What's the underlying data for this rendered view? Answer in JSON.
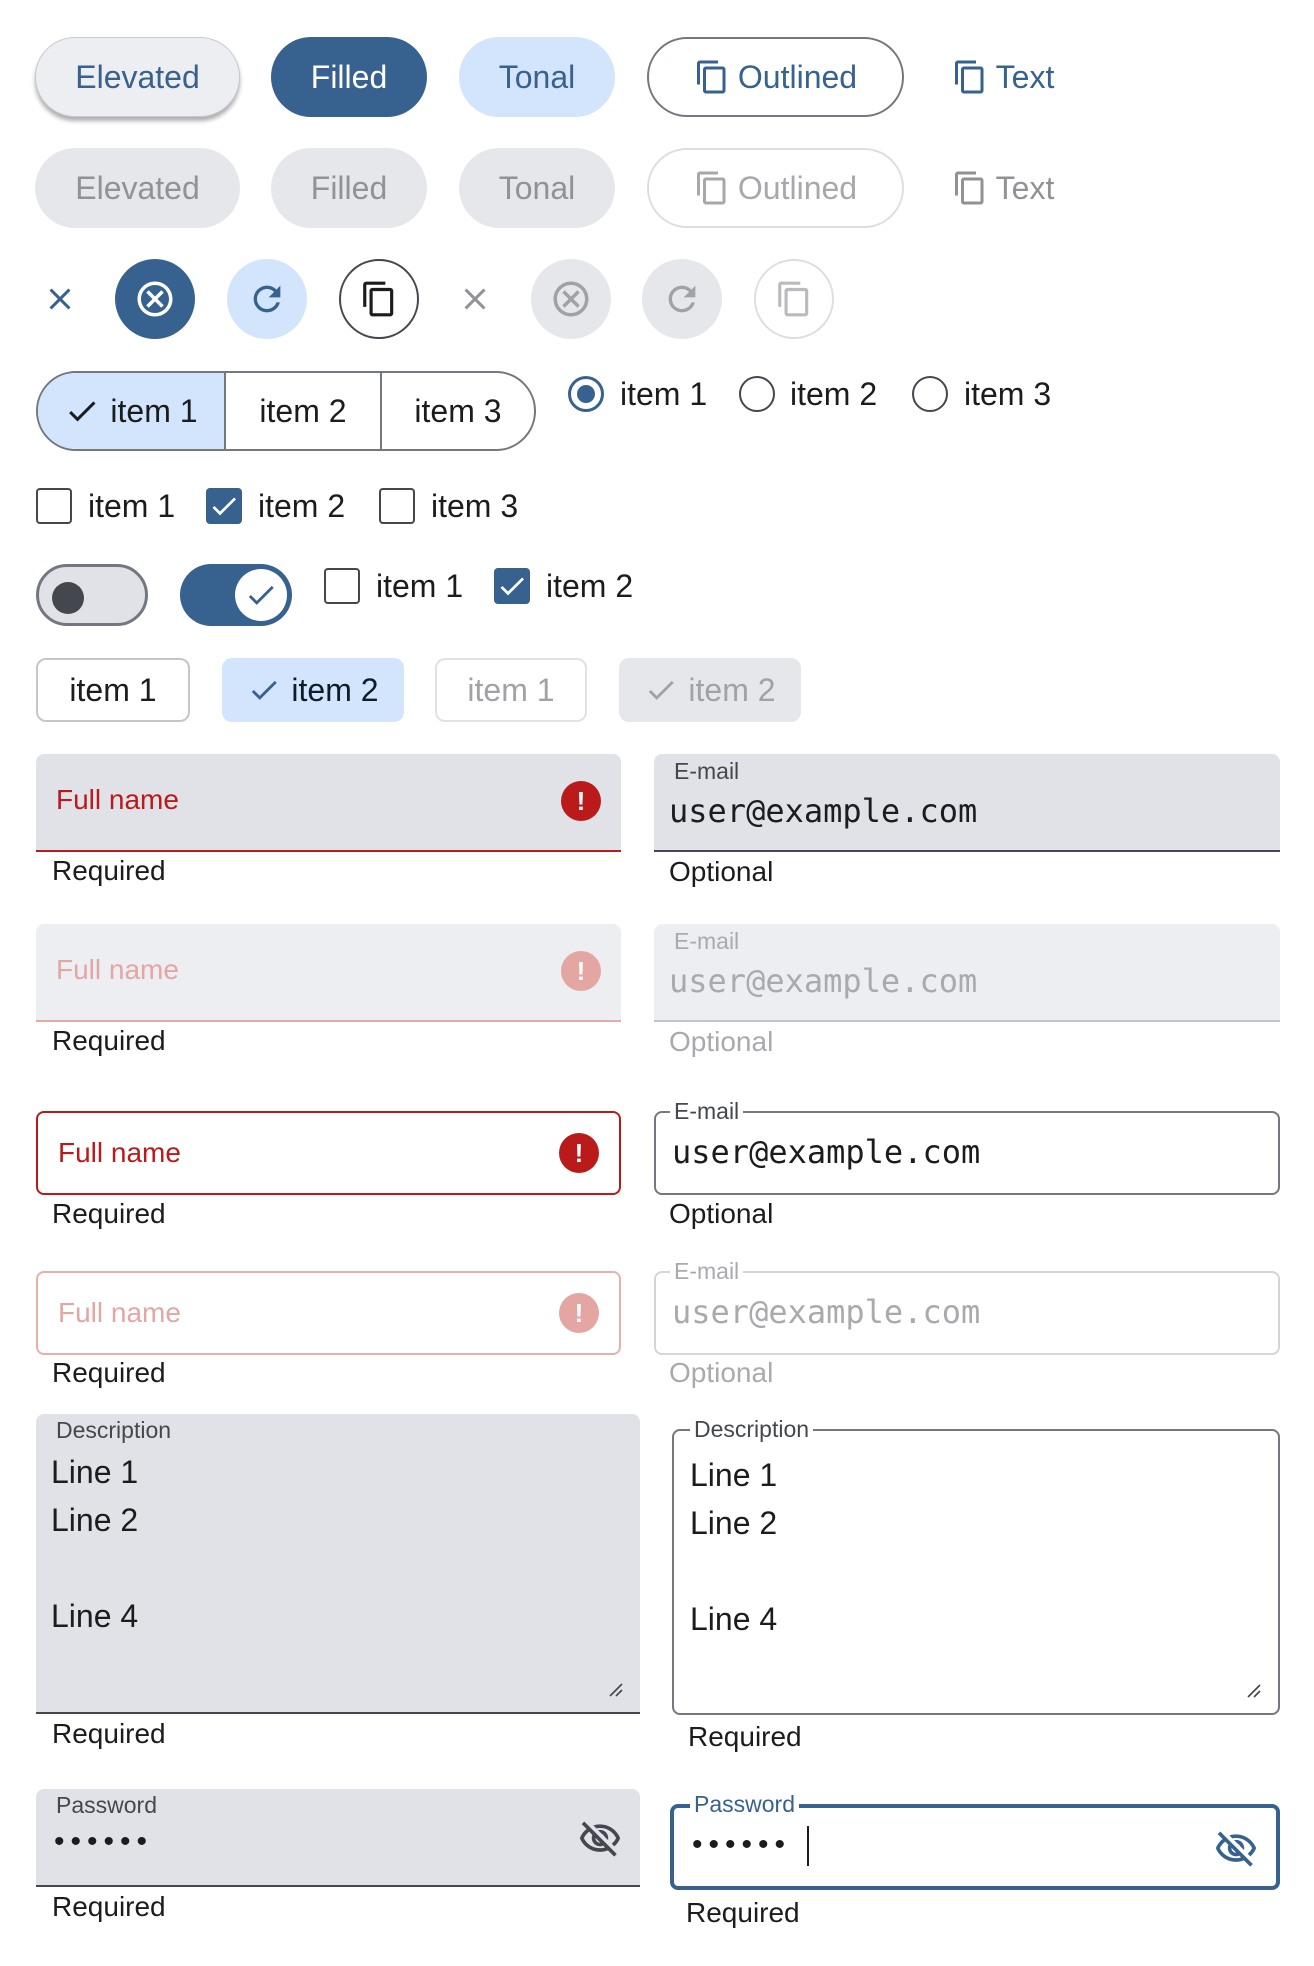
{
  "colors": {
    "primary": "#37618e",
    "tonal": "#d3e4fd",
    "error": "#ba1a1a",
    "surface_filled": "#e1e2e8"
  },
  "buttons": {
    "enabled": {
      "elevated": "Elevated",
      "filled": "Filled",
      "tonal": "Tonal",
      "outlined": "Outlined",
      "text": "Text"
    },
    "disabled": {
      "elevated": "Elevated",
      "filled": "Filled",
      "tonal": "Tonal",
      "outlined": "Outlined",
      "text": "Text"
    },
    "icons": {
      "outlined": "copy-icon",
      "text": "copy-icon"
    }
  },
  "icon_buttons": {
    "enabled": [
      "close-icon",
      "cancel-icon",
      "refresh-icon",
      "copy-icon"
    ],
    "disabled": [
      "close-icon",
      "cancel-icon",
      "refresh-icon",
      "copy-icon"
    ]
  },
  "segmented": {
    "items": [
      "item 1",
      "item 2",
      "item 3"
    ],
    "selected_index": 0
  },
  "radios": {
    "items": [
      "item 1",
      "item 2",
      "item 3"
    ],
    "selected_index": 0
  },
  "checkboxes": {
    "items": [
      "item 1",
      "item 2",
      "item 3"
    ],
    "checked": [
      false,
      true,
      false
    ]
  },
  "switches": {
    "states": [
      false,
      true
    ]
  },
  "switch_checkboxes": {
    "items": [
      "item 1",
      "item 2"
    ],
    "checked": [
      false,
      true
    ]
  },
  "chips": {
    "enabled": [
      {
        "label": "item 1",
        "selected": false
      },
      {
        "label": "item 2",
        "selected": true
      }
    ],
    "disabled": [
      {
        "label": "item 1",
        "selected": false
      },
      {
        "label": "item 2",
        "selected": true
      }
    ]
  },
  "fields": {
    "fullname": {
      "placeholder": "Full name",
      "supporting": "Required"
    },
    "email": {
      "label": "E-mail",
      "value": "user@example.com",
      "supporting": "Optional"
    },
    "description": {
      "label": "Description",
      "lines": [
        "Line 1",
        "Line 2",
        "",
        "Line 4"
      ],
      "supporting": "Required"
    },
    "password": {
      "label": "Password",
      "value": "••••••",
      "supporting": "Required",
      "icon": "visibility-off-icon"
    }
  }
}
